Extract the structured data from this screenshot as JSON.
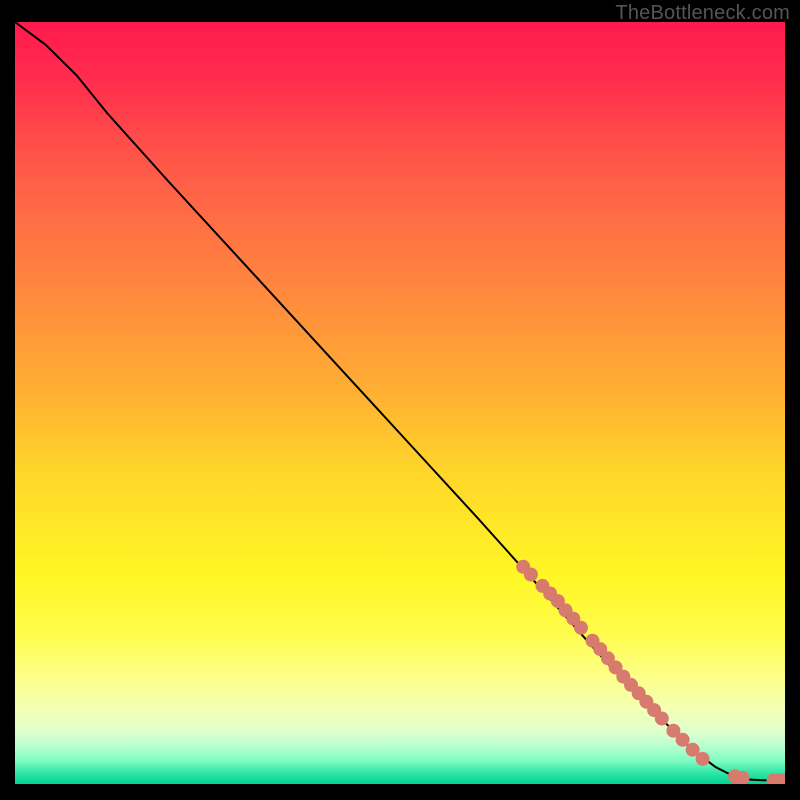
{
  "watermark": "TheBottleneck.com",
  "chart_data": {
    "type": "line",
    "title": "",
    "xlabel": "",
    "ylabel": "",
    "x_range": [
      0,
      100
    ],
    "y_range": [
      0,
      100
    ],
    "curve": [
      {
        "x": 0,
        "y": 100
      },
      {
        "x": 4,
        "y": 97
      },
      {
        "x": 8,
        "y": 93
      },
      {
        "x": 12,
        "y": 88
      },
      {
        "x": 20,
        "y": 79
      },
      {
        "x": 30,
        "y": 68
      },
      {
        "x": 40,
        "y": 57
      },
      {
        "x": 50,
        "y": 46
      },
      {
        "x": 60,
        "y": 35
      },
      {
        "x": 68,
        "y": 26
      },
      {
        "x": 75,
        "y": 18
      },
      {
        "x": 80,
        "y": 12.5
      },
      {
        "x": 85,
        "y": 7.5
      },
      {
        "x": 88,
        "y": 4.5
      },
      {
        "x": 91,
        "y": 2.2
      },
      {
        "x": 93,
        "y": 1.2
      },
      {
        "x": 95,
        "y": 0.6
      },
      {
        "x": 97,
        "y": 0.5
      },
      {
        "x": 99,
        "y": 0.5
      },
      {
        "x": 100,
        "y": 0.5
      }
    ],
    "scatter": [
      {
        "x": 66,
        "y": 28.5
      },
      {
        "x": 67,
        "y": 27.5
      },
      {
        "x": 68.5,
        "y": 26
      },
      {
        "x": 69.5,
        "y": 25
      },
      {
        "x": 70.5,
        "y": 24
      },
      {
        "x": 71.5,
        "y": 22.8
      },
      {
        "x": 72.5,
        "y": 21.7
      },
      {
        "x": 73.5,
        "y": 20.5
      },
      {
        "x": 75,
        "y": 18.8
      },
      {
        "x": 76,
        "y": 17.7
      },
      {
        "x": 77,
        "y": 16.5
      },
      {
        "x": 78,
        "y": 15.3
      },
      {
        "x": 79,
        "y": 14.1
      },
      {
        "x": 80,
        "y": 13
      },
      {
        "x": 81,
        "y": 11.9
      },
      {
        "x": 82,
        "y": 10.8
      },
      {
        "x": 83,
        "y": 9.7
      },
      {
        "x": 84,
        "y": 8.6
      },
      {
        "x": 85.5,
        "y": 7
      },
      {
        "x": 86.7,
        "y": 5.8
      },
      {
        "x": 88,
        "y": 4.5
      },
      {
        "x": 89.3,
        "y": 3.3
      },
      {
        "x": 93.5,
        "y": 1
      },
      {
        "x": 94.5,
        "y": 0.8
      },
      {
        "x": 98.5,
        "y": 0.5
      },
      {
        "x": 99.5,
        "y": 0.5
      }
    ],
    "scatter_radius": 7
  }
}
